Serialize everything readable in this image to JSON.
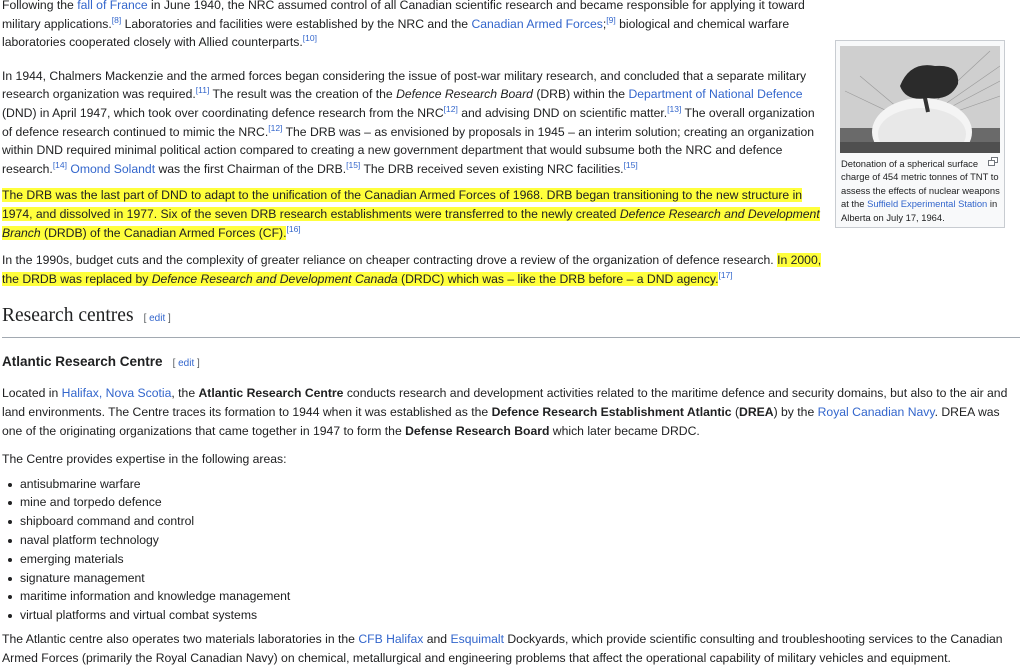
{
  "p1": {
    "t1": "Following the ",
    "l1": "fall of France",
    "t2": " in June 1940, the NRC assumed control of all Canadian scientific research and became responsible for applying it toward military applications.",
    "r1": "[8]",
    "t3": " Laboratories and facilities were established by the NRC and the ",
    "l2": "Canadian Armed Forces",
    "t4": ";",
    "r2": "[9]",
    "t5": " biological and chemical warfare laboratories cooperated closely with Allied counterparts.",
    "r3": "[10]"
  },
  "p2": {
    "t1": "In 1944, Chalmers Mackenzie and the armed forces began considering the issue of post-war military research, and concluded that a separate military research organization was required.",
    "r1": "[11]",
    "t2": " The result was the creation of the ",
    "i1": "Defence Research Board",
    "t3": " (DRB) within the ",
    "l1": "Department of National Defence",
    "t4": " (DND) in April 1947, which took over coordinating defence research from the NRC",
    "r2": "[12]",
    "t5": " and advising DND on scientific matter.",
    "r3": "[13]",
    "t6": " The overall organization of defence research continued to mimic the NRC.",
    "r4": "[12]",
    "t7": " The DRB was – as envisioned by proposals in 1945 – an interim solution; creating an organization within DND required minimal political action compared to creating a new government department that would subsume both the NRC and defence research.",
    "r5": "[14]",
    "t8": " ",
    "l2": "Omond Solandt",
    "t9": " was the first Chairman of the DRB.",
    "r6": "[15]",
    "t10": " The DRB received seven existing NRC facilities.",
    "r7": "[15]"
  },
  "p3": {
    "t1": "The DRB was the last part of DND to adapt to the unification of the Canadian Armed Forces of 1968. DRB began transitioning to the new structure in 1974, and dissolved in 1977. Six of the seven DRB research establishments were transferred to the newly created ",
    "i1": "Defence Research and Development Branch",
    "t2": " (DRDB) of the Canadian Armed Forces (CF).",
    "r1": "[16]"
  },
  "p4": {
    "t1": "In the 1990s, budget cuts and the complexity of greater reliance on cheaper contracting drove a review of the organization of defence research. ",
    "h1": "In 2000, the DRDB was replaced by ",
    "i1": "Defence Research and Development Canada",
    "h2": " (DRDC) which was – like the DRB before – a DND agency.",
    "r1": "[17]"
  },
  "sections": {
    "research_centres": "Research centres",
    "atlantic": "Atlantic Research Centre",
    "edit_open": "[ ",
    "edit_label": "edit",
    "edit_close": " ]"
  },
  "p5": {
    "t1": "Located in ",
    "l1": "Halifax, Nova Scotia",
    "t2": ", the ",
    "b1": "Atlantic Research Centre",
    "t3": " conducts research and development activities related to the maritime defence and security domains, but also to the air and land environments. The Centre traces its formation to 1944 when it was established as the ",
    "b2": "Defence Research Establishment Atlantic",
    "t4": " (",
    "b3": "DREA",
    "t5": ") by the ",
    "l2": "Royal Canadian Navy",
    "t6": ". DREA was one of the originating organizations that came together in 1947 to form the ",
    "b4": "Defense Research Board",
    "t7": " which later became DRDC."
  },
  "p6": "The Centre provides expertise in the following areas:",
  "areas": [
    "antisubmarine warfare",
    "mine and torpedo defence",
    "shipboard command and control",
    "naval platform technology",
    "emerging materials",
    "signature management",
    "maritime information and knowledge management",
    "virtual platforms and virtual combat systems"
  ],
  "p7": {
    "t1": "The Atlantic centre also operates two materials laboratories in the ",
    "l1": "CFB Halifax",
    "t2": " and ",
    "l2": "Esquimalt",
    "t3": " Dockyards, which provide scientific consulting and troubleshooting services to the Canadian Armed Forces (primarily the Royal Canadian Navy) on chemical, metallurgical and engineering problems that affect the operational capability of military vehicles and equipment."
  },
  "thumb": {
    "c1": "Detonation of a spherical surface charge of 454 metric tonnes of TNT to assess the effects of nuclear weapons at the ",
    "l1": "Suffield Experimental Station",
    "c2": " in Alberta on July 17, 1964.",
    "icon": "enlarge-icon"
  },
  "colors": {
    "link": "#3366cc",
    "highlight": "#ffff3c",
    "text": "#202122"
  }
}
